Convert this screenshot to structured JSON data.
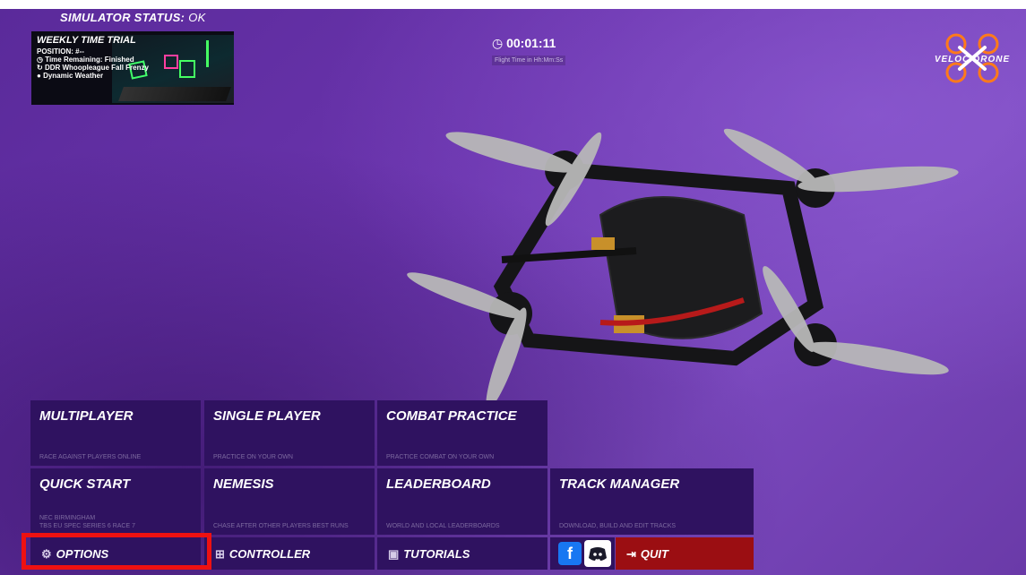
{
  "status": {
    "label": "SIMULATOR STATUS:",
    "value": "OK"
  },
  "trial": {
    "title": "WEEKLY TIME TRIAL",
    "position": "POSITION: #--",
    "time_remaining": "Time Remaining: Finished",
    "track": "DDR Whoopleague Fall Frenzy",
    "weather": "Dynamic Weather"
  },
  "timer": {
    "value": "00:01:11",
    "caption": "Flight Time in Hh:Mm:Ss"
  },
  "logo": {
    "text": "VELOCIDRONE"
  },
  "menu": {
    "multiplayer": {
      "title": "MULTIPLAYER",
      "sub": "RACE AGAINST PLAYERS ONLINE"
    },
    "single_player": {
      "title": "SINGLE PLAYER",
      "sub": "PRACTICE ON YOUR OWN"
    },
    "combat_practice": {
      "title": "COMBAT PRACTICE",
      "sub": "PRACTICE COMBAT ON YOUR OWN"
    },
    "quick_start": {
      "title": "QUICK START",
      "sub1": "NEC BIRMINGHAM",
      "sub2": "TBS EU SPEC SERIES 6 RACE 7"
    },
    "nemesis": {
      "title": "NEMESIS",
      "sub": "CHASE AFTER OTHER PLAYERS BEST RUNS"
    },
    "leaderboard": {
      "title": "LEADERBOARD",
      "sub": "WORLD AND LOCAL LEADERBOARDS"
    },
    "track_manager": {
      "title": "TRACK MANAGER",
      "sub": "DOWNLOAD, BUILD AND EDIT TRACKS"
    }
  },
  "bottom": {
    "options": "OPTIONS",
    "controller": "CONTROLLER",
    "tutorials": "TUTORIALS",
    "facebook": "f",
    "quit": "QUIT"
  },
  "colors": {
    "tile": "#2f1260",
    "quit": "#9b0e12",
    "highlight": "#ee1111",
    "facebook": "#1877f2"
  }
}
